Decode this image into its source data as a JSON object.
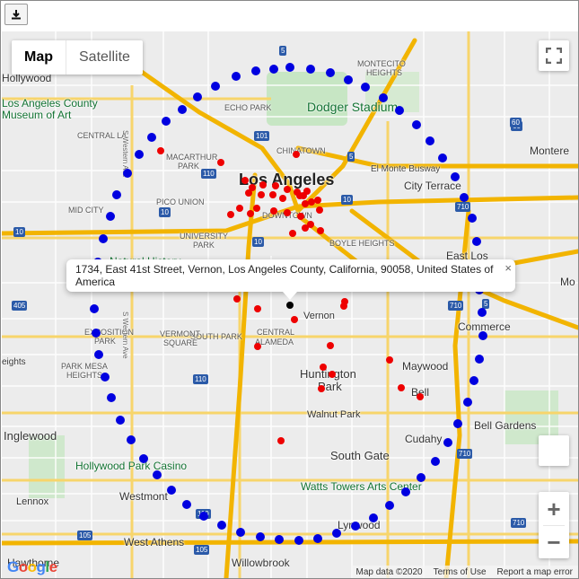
{
  "toolbar": {
    "download_icon": "download-icon"
  },
  "map_type": {
    "map_label": "Map",
    "satellite_label": "Satellite"
  },
  "popup": {
    "text": "1734, East 41st Street, Vernon, Los Angeles County, California, 90058, United States of America",
    "close": "×"
  },
  "controls": {
    "fullscreen_icon": "fullscreen-icon",
    "zoom_in": "+",
    "zoom_out": "−"
  },
  "footer": {
    "map_data": "Map data ©2020",
    "terms": "Terms of Use",
    "report": "Report a map error"
  },
  "logo": "Google",
  "markers": {
    "blue": "#0000e0",
    "red": "#ee0000",
    "selected": "#000000"
  },
  "place_labels": [
    {
      "id": "los-angeles",
      "text": "Los Angeles"
    },
    {
      "id": "dodger-stadium",
      "text": "Dodger Stadium"
    },
    {
      "id": "la-county-museum",
      "text": "Los Angeles County"
    },
    {
      "id": "la-county-museum-2",
      "text": "Museum of Art"
    },
    {
      "id": "echo-park",
      "text": "ECHO PARK"
    },
    {
      "id": "montecito-heights",
      "text": "MONTECITO"
    },
    {
      "id": "montecito-heights-2",
      "text": "HEIGHTS"
    },
    {
      "id": "hollywood",
      "text": "Hollywood"
    },
    {
      "id": "central-la",
      "text": "CENTRAL LA"
    },
    {
      "id": "macarthur-park",
      "text": "MACARTHUR"
    },
    {
      "id": "macarthur-park-2",
      "text": "PARK"
    },
    {
      "id": "chinatown",
      "text": "CHINATOWN"
    },
    {
      "id": "el-monte-busway",
      "text": "El Monte Busway"
    },
    {
      "id": "city-terrace",
      "text": "City Terrace"
    },
    {
      "id": "monterey",
      "text": "Montere"
    },
    {
      "id": "mid-city",
      "text": "MID CITY"
    },
    {
      "id": "pico-union",
      "text": "PICO UNION"
    },
    {
      "id": "downtown",
      "text": "DOWNTOWN"
    },
    {
      "id": "university-park",
      "text": "UNIVERSITY"
    },
    {
      "id": "university-park-2",
      "text": "PARK"
    },
    {
      "id": "boyle-heights",
      "text": "BOYLE HEIGHTS"
    },
    {
      "id": "east-los",
      "text": "East Los"
    },
    {
      "id": "natural-history",
      "text": "Natural History"
    },
    {
      "id": "vernon",
      "text": "Vernon"
    },
    {
      "id": "commerce",
      "text": "Commerce"
    },
    {
      "id": "south-park",
      "text": "SOUTH PARK"
    },
    {
      "id": "central-alameda",
      "text": "CENTRAL"
    },
    {
      "id": "central-alameda-2",
      "text": "ALAMEDA"
    },
    {
      "id": "vermont-square",
      "text": "VERMONT"
    },
    {
      "id": "vermont-square-2",
      "text": "SQUARE"
    },
    {
      "id": "exposition-park",
      "text": "EXPOSITION"
    },
    {
      "id": "exposition-park-2",
      "text": "PARK"
    },
    {
      "id": "heights",
      "text": "eights"
    },
    {
      "id": "park-mesa",
      "text": "PARK MESA"
    },
    {
      "id": "park-mesa-2",
      "text": "HEIGHTS"
    },
    {
      "id": "maywood",
      "text": "Maywood"
    },
    {
      "id": "huntington-park",
      "text": "Huntington"
    },
    {
      "id": "huntington-park-2",
      "text": "Park"
    },
    {
      "id": "bell",
      "text": "Bell"
    },
    {
      "id": "walnut-park",
      "text": "Walnut Park"
    },
    {
      "id": "bell-gardens",
      "text": "Bell Gardens"
    },
    {
      "id": "inglewood",
      "text": "Inglewood"
    },
    {
      "id": "cudahy",
      "text": "Cudahy"
    },
    {
      "id": "south-gate",
      "text": "South Gate"
    },
    {
      "id": "hollywood-park-casino",
      "text": "Hollywood Park Casino"
    },
    {
      "id": "watts-towers",
      "text": "Watts Towers Arts Center"
    },
    {
      "id": "westmont",
      "text": "Westmont"
    },
    {
      "id": "lennox",
      "text": "Lennox"
    },
    {
      "id": "lynwood",
      "text": "Lynwood"
    },
    {
      "id": "west-athens",
      "text": "West Athens"
    },
    {
      "id": "willowbrook",
      "text": "Willowbrook"
    },
    {
      "id": "mo",
      "text": "Mo"
    },
    {
      "id": "do",
      "text": "Do"
    },
    {
      "id": "hawthorne",
      "text": "Hawthorne"
    },
    {
      "id": "s-western-ave",
      "text": "S Western Ave"
    },
    {
      "id": "s-western-ave-2",
      "text": "S Western Ave"
    }
  ],
  "route_shields": [
    "101",
    "5",
    "110",
    "10",
    "10",
    "10",
    "10",
    "5",
    "60",
    "5",
    "60",
    "710",
    "710",
    "110",
    "110",
    "105",
    "105",
    "710",
    "710",
    "405"
  ]
}
